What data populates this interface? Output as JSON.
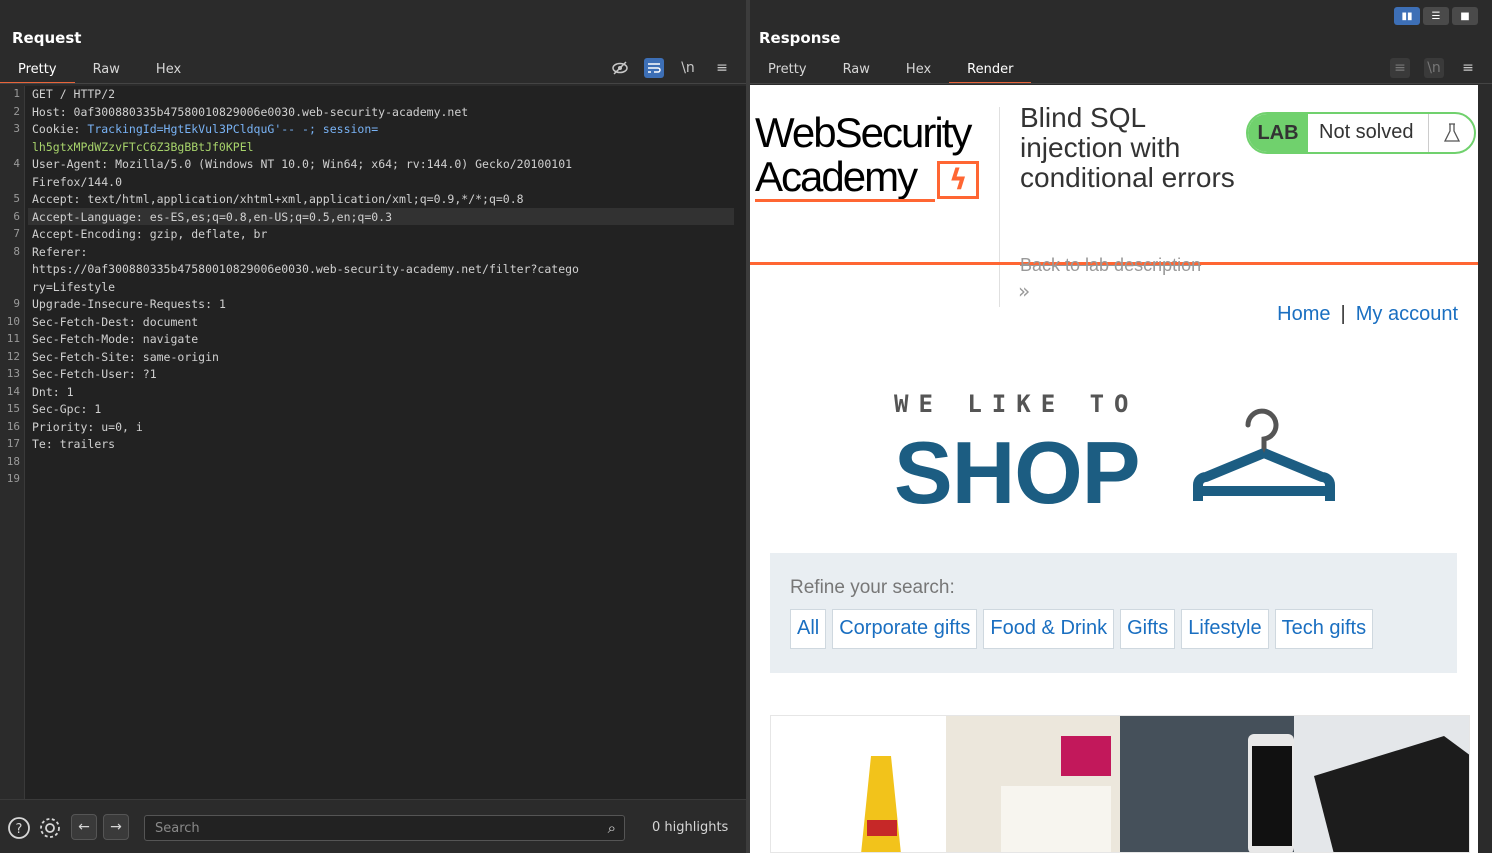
{
  "request": {
    "title": "Request",
    "tabs": [
      "Pretty",
      "Raw",
      "Hex"
    ],
    "active_tab": "Pretty",
    "lines": [
      {
        "n": "1",
        "key": "GET / HTTP/2",
        "val": ""
      },
      {
        "n": "2",
        "key": "Host:",
        "val": " 0af300880335b47580010829006e0030.web-security-academy.net"
      },
      {
        "n": "3",
        "key": "Cookie:",
        "val": " TrackingId=HgtEkVul3PCldquG'-- -; session="
      },
      {
        "n": "",
        "key": "",
        "val": "lh5gtxMPdWZzvFTcC6Z3BgBBtJf0KPEl"
      },
      {
        "n": "4",
        "key": "User-Agent:",
        "val": " Mozilla/5.0 (Windows NT 10.0; Win64; x64; rv:144.0) Gecko/20100101"
      },
      {
        "n": "",
        "key": "",
        "val": "Firefox/144.0"
      },
      {
        "n": "5",
        "key": "Accept:",
        "val": " text/html,application/xhtml+xml,application/xml;q=0.9,*/*;q=0.8"
      },
      {
        "n": "6",
        "key": "Accept-Language:",
        "val": " es-ES,es;q=0.8,en-US;q=0.5,en;q=0.3"
      },
      {
        "n": "7",
        "key": "Accept-Encoding:",
        "val": " gzip, deflate, br"
      },
      {
        "n": "8",
        "key": "Referer:",
        "val": ""
      },
      {
        "n": "",
        "key": "",
        "val": "https://0af300880335b47580010829006e0030.web-security-academy.net/filter?catego"
      },
      {
        "n": "",
        "key": "",
        "val": "ry=Lifestyle"
      },
      {
        "n": "9",
        "key": "Upgrade-Insecure-Requests:",
        "val": " 1"
      },
      {
        "n": "10",
        "key": "Sec-Fetch-Dest:",
        "val": " document"
      },
      {
        "n": "11",
        "key": "Sec-Fetch-Mode:",
        "val": " navigate"
      },
      {
        "n": "12",
        "key": "Sec-Fetch-Site:",
        "val": " same-origin"
      },
      {
        "n": "13",
        "key": "Sec-Fetch-User:",
        "val": " ?1"
      },
      {
        "n": "14",
        "key": "Dnt:",
        "val": " 1"
      },
      {
        "n": "15",
        "key": "Sec-Gpc:",
        "val": " 1"
      },
      {
        "n": "16",
        "key": "Priority:",
        "val": " u=0, i"
      },
      {
        "n": "17",
        "key": "Te:",
        "val": " trailers"
      },
      {
        "n": "18",
        "key": "",
        "val": ""
      },
      {
        "n": "19",
        "key": "",
        "val": ""
      }
    ],
    "search_placeholder": "Search",
    "highlights": "0 highlights"
  },
  "response": {
    "title": "Response",
    "tabs": [
      "Pretty",
      "Raw",
      "Hex",
      "Render"
    ],
    "active_tab": "Render",
    "page": {
      "logo_line1": "WebSecurity",
      "logo_line2": "Academy",
      "lab_title": "Blind SQL injection with conditional errors",
      "back_link": "Back to lab description",
      "back_chevron": "»",
      "lab_tag": "LAB",
      "lab_status": "Not solved",
      "nav_home": "Home",
      "nav_sep": "|",
      "nav_account": "My account",
      "banner_top": "WE LIKE TO",
      "banner_main": "SHOP",
      "refine_label": "Refine your search:",
      "filters": [
        "All",
        "Corporate gifts",
        "Food & Drink",
        "Gifts",
        "Lifestyle",
        "Tech gifts"
      ]
    }
  },
  "colors": {
    "accent_orange": "#e8643a",
    "burp_blue": "#3d6fb6",
    "lab_green": "#70d16d",
    "shop_blue": "#1c5d82",
    "link_blue": "#1a6fc1"
  }
}
